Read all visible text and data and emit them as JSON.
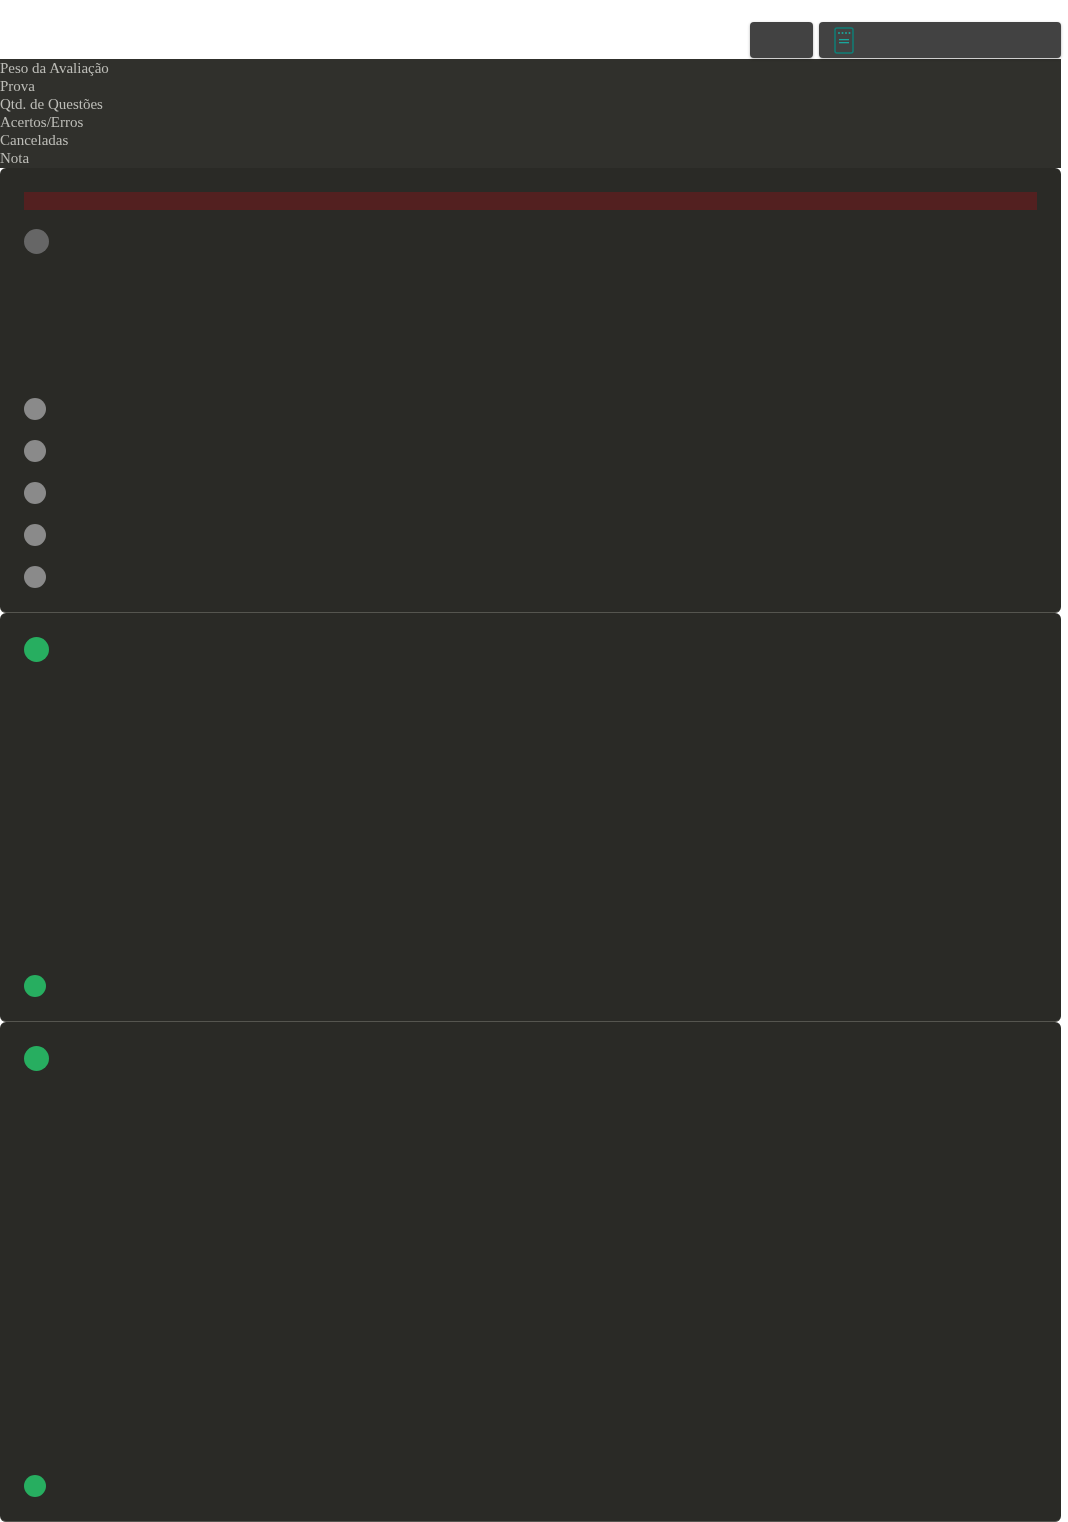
{
  "header_labels": [
    "Peso da Avaliação",
    "Prova",
    "Qtd. de Questões",
    "Acertos/Erros",
    "Canceladas",
    "Nota"
  ],
  "cards": [
    {
      "kind": "alert",
      "color": "#666666",
      "items": [
        {
          "color": "#8a8a8a"
        },
        {
          "color": "#8a8a8a"
        },
        {
          "color": "#8a8a8a"
        },
        {
          "color": "#8a8a8a"
        },
        {
          "color": "#8a8a8a"
        }
      ]
    },
    {
      "kind": "plain",
      "color": "#27ae60",
      "items": [
        {
          "color": "#27ae60"
        }
      ]
    },
    {
      "kind": "plain",
      "color": "#27ae60",
      "items": [
        {
          "color": "#27ae60"
        }
      ]
    }
  ]
}
